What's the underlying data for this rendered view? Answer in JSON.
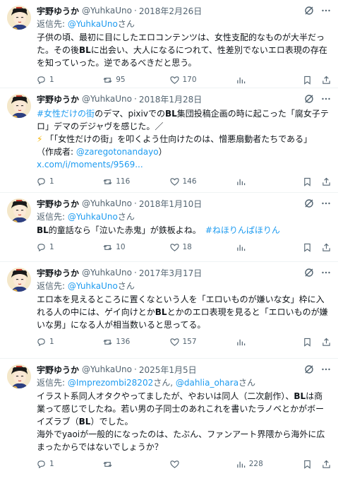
{
  "tweets": [
    {
      "name": "宇野ゆうか",
      "handle": "@YuhkaUno",
      "date": "2018年2月26日",
      "reply_prefix": "返信先: ",
      "reply_handle": "@YuhkaUno",
      "reply_suffix": "さん",
      "line1": "子供の頃、最初に目にしたエロコンテンツは、女性支配的なものが大半だっ",
      "line2a": "た。その後",
      "line2b": "BL",
      "line2c": "に出会い、大人になるにつれて、性差別でないエロ表現の存在",
      "line3": "を知っていった。逆であるべきだと思う。",
      "replies": "1",
      "retweets": "95",
      "likes": "170"
    },
    {
      "name": "宇野ゆうか",
      "handle": "@YuhkaUno",
      "date": "2018年1月28日",
      "hashtag": "#女性だけの街",
      "line1a": "のデマ、pixivでの",
      "line1b": "BL",
      "line1c": "集団投稿企画の時に起こった「腐女子テ",
      "line2": "ロ」デマのデジャヴを感じた。／",
      "bolt": "⚡",
      "line3": "「「女性だけの街」を叩くよう仕向けたのは、憎悪扇動者たちである」",
      "line4a": "（作成者: ",
      "line4b": "@zaregotonandayo",
      "line4c": "）",
      "link": "x.com/i/moments/9569...",
      "replies": "1",
      "retweets": "116",
      "likes": "146"
    },
    {
      "name": "宇野ゆうか",
      "handle": "@YuhkaUno",
      "date": "2018年1月10日",
      "reply_prefix": "返信先: ",
      "reply_handle": "@YuhkaUno",
      "reply_suffix": "さん",
      "line1a": "BL",
      "line1b": "的童話なら「泣いた赤鬼」が鉄板よね。",
      "hashtag": "#ねほりんぱほりん",
      "replies": "1",
      "retweets": "10",
      "likes": "18"
    },
    {
      "name": "宇野ゆうか",
      "handle": "@YuhkaUno",
      "date": "2017年3月17日",
      "reply_prefix": "返信先: ",
      "reply_handle": "@YuhkaUno",
      "reply_suffix": "さん",
      "line1": "エロ本を見えるところに置くなという人を「エロいものが嫌いな女」枠に入",
      "line2a": "れる人の中には、ゲイ向けとか",
      "line2b": "BL",
      "line2c": "とかのエロ表現を見ると「エロいものが嫌",
      "line3": "いな男」になる人が相当数いると思ってる。",
      "replies": "1",
      "retweets": "136",
      "likes": "157"
    },
    {
      "name": "宇野ゆうか",
      "handle": "@YuhkaUno",
      "date": "2025年1月5日",
      "reply_prefix": "返信先: ",
      "reply_handle1": "@Imprezombi28202",
      "reply_mid": "さん, ",
      "reply_handle2": "@dahlia_ohara",
      "reply_suffix": "さん",
      "line1a": "イラスト系同人オタクやってましたが、やおいは同人（二次創作）、",
      "line1b": "BL",
      "line1c": "は商",
      "line2": "業って感じでしたね。若い男の子同士のあれこれを書いたラノベとかがボー",
      "line3a": "イズラブ（",
      "line3b": "BL",
      "line3c": "）でした。",
      "line4": "海外でyaoiが一般的になったのは、たぶん、ファンアート界隈から海外に広",
      "line5": "まったからではないでしょうか？",
      "replies": "1",
      "retweets": "",
      "views": "228"
    }
  ]
}
